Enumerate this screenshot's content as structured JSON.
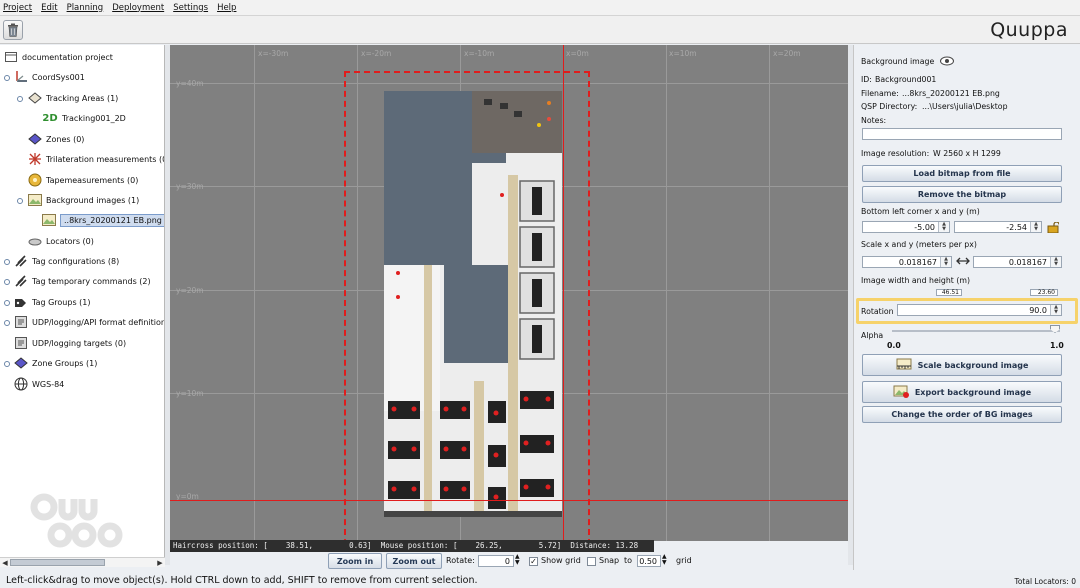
{
  "menu": [
    "Project",
    "Edit",
    "Planning",
    "Deployment",
    "Settings",
    "Help"
  ],
  "brand": "Quuppa",
  "tree": {
    "items": [
      {
        "label": "documentation project",
        "icon": "project-icon"
      },
      {
        "label": "CoordSys001",
        "icon": "coordsys-icon"
      },
      {
        "label": "Tracking Areas (1)",
        "icon": "tracking-areas-icon"
      },
      {
        "label": "Tracking001_2D",
        "icon": "tracking-2d-icon",
        "badge": "2D"
      },
      {
        "label": "Zones (0)",
        "icon": "zones-icon"
      },
      {
        "label": "Trilateration measurements (0",
        "icon": "trilateration-icon"
      },
      {
        "label": "Tapemeasurements (0)",
        "icon": "tapemeasure-icon"
      },
      {
        "label": "Background images (1)",
        "icon": "background-images-icon"
      },
      {
        "label": "..8krs_20200121 EB.png",
        "icon": "image-file-icon"
      },
      {
        "label": "Locators (0)",
        "icon": "locators-icon"
      },
      {
        "label": "Tag configurations (8)",
        "icon": "tag-config-icon"
      },
      {
        "label": "Tag temporary commands (2)",
        "icon": "tag-commands-icon"
      },
      {
        "label": "Tag Groups (1)",
        "icon": "tag-groups-icon"
      },
      {
        "label": "UDP/logging/API format definitions (",
        "icon": "udp-format-icon"
      },
      {
        "label": "UDP/logging targets (0)",
        "icon": "udp-targets-icon"
      },
      {
        "label": "Zone Groups (1)",
        "icon": "zone-groups-icon"
      },
      {
        "label": "WGS-84",
        "icon": "globe-icon"
      }
    ]
  },
  "canvas": {
    "x_labels": [
      "x=-30m",
      "x=-20m",
      "x=-10m",
      "x=0m",
      "x=10m",
      "x=20m"
    ],
    "y_labels": [
      "y=40m",
      "y=30m",
      "y=20m",
      "y=10m",
      "y=0m"
    ],
    "info": "Haircross position: [    38.51,        0.63]  Mouse position: [    26.25,        5.72]  Distance: 13.28"
  },
  "controls": {
    "zoom_in": "Zoom in",
    "zoom_out": "Zoom out",
    "rotate_label": "Rotate:",
    "rotate_value": "0",
    "show_grid": "Show grid",
    "show_grid_checked": true,
    "snap": "Snap",
    "snap_checked": false,
    "to": "to",
    "snap_value": "0.50",
    "grid": "grid"
  },
  "status": {
    "left": "Left-click&drag to move object(s). Hold CTRL down to add, SHIFT to remove from current selection.",
    "right": "Total Locators: 0"
  },
  "panel": {
    "title": "Background image",
    "id_label": "ID:",
    "id_value": "Background001",
    "filename_label": "Filename:",
    "filename_value": "...8krs_20200121 EB.png",
    "qsp_label": "QSP Directory:",
    "qsp_value": "...\\Users\\julia\\Desktop",
    "notes_label": "Notes:",
    "notes_value": "",
    "resolution_label": "Image resolution:",
    "resolution_value": "W 2560 x H 1299",
    "load_btn": "Load bitmap from file",
    "remove_btn": "Remove the bitmap",
    "corner_label": "Bottom left corner x and y (m)",
    "corner_x": "-5.00",
    "corner_y": "-2.54",
    "scale_label": "Scale x and y (meters per px)",
    "scale_x": "0.018167",
    "scale_y": "0.018167",
    "size_label": "Image width and height (m)",
    "size_w": "46.51",
    "size_h": "23.60",
    "rotation_label": "Rotation",
    "rotation_value": "90.0",
    "alpha_label": "Alpha",
    "alpha_min": "0.0",
    "alpha_max": "1.0",
    "scale_btn": "Scale background image",
    "export_btn": "Export background image",
    "order_btn": "Change the order of BG images"
  }
}
